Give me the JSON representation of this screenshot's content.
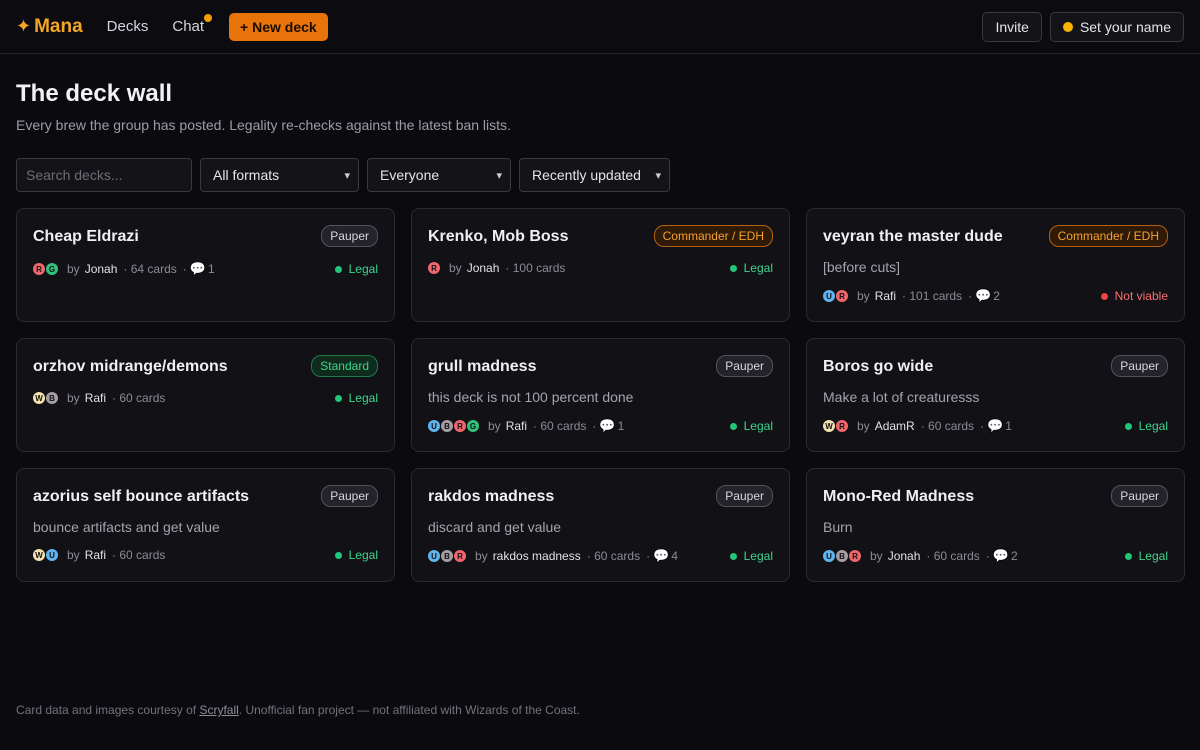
{
  "app": {
    "brand_icon": "✦",
    "brand_name": "Mana"
  },
  "nav": {
    "decks_label": "Decks",
    "chat_label": "Chat",
    "new_deck_label": "+ New deck"
  },
  "header_actions": {
    "invite_label": "Invite",
    "set_name_label": "Set your name"
  },
  "page": {
    "title": "The deck wall",
    "subtitle": "Every brew the group has posted. Legality re-checks against the latest ban lists."
  },
  "filters": {
    "search_placeholder": "Search decks...",
    "format_selected": "All formats",
    "owner_selected": "Everyone",
    "sort_selected": "Recently updated"
  },
  "decks": [
    {
      "title": "Cheap Eldrazi",
      "format": "Pauper",
      "format_style": "pauper",
      "description": "",
      "colors": [
        "R",
        "G"
      ],
      "by_label": "by",
      "author": "Jonah",
      "cards": "· 64 cards",
      "comments": "1",
      "status": "Legal",
      "status_ok": true
    },
    {
      "title": "Krenko, Mob Boss",
      "format": "Commander / EDH",
      "format_style": "edh",
      "description": "",
      "colors": [
        "R"
      ],
      "by_label": "by",
      "author": "Jonah",
      "cards": "· 100 cards",
      "comments": "",
      "status": "Legal",
      "status_ok": true
    },
    {
      "title": "veyran the master dude",
      "format": "Commander / EDH",
      "format_style": "edh",
      "description": "[before cuts]",
      "colors": [
        "U",
        "R"
      ],
      "by_label": "by",
      "author": "Rafi",
      "cards": "· 101 cards",
      "comments": "2",
      "status": "Not viable",
      "status_ok": false
    },
    {
      "title": "orzhov midrange/demons",
      "format": "Standard",
      "format_style": "standard",
      "description": "",
      "colors": [
        "W",
        "B"
      ],
      "by_label": "by",
      "author": "Rafi",
      "cards": "· 60 cards",
      "comments": "",
      "status": "Legal",
      "status_ok": true
    },
    {
      "title": "grull madness",
      "format": "Pauper",
      "format_style": "pauper",
      "description": "this deck is not 100 percent done",
      "colors": [
        "U",
        "B",
        "R",
        "G"
      ],
      "by_label": "by",
      "author": "Rafi",
      "cards": "· 60 cards",
      "comments": "1",
      "status": "Legal",
      "status_ok": true
    },
    {
      "title": "Boros go wide",
      "format": "Pauper",
      "format_style": "pauper",
      "description": "Make a lot of creaturesss",
      "colors": [
        "W",
        "R"
      ],
      "by_label": "by",
      "author": "AdamR",
      "cards": "· 60 cards",
      "comments": "1",
      "status": "Legal",
      "status_ok": true
    },
    {
      "title": "azorius self bounce artifacts",
      "format": "Pauper",
      "format_style": "pauper",
      "description": "bounce artifacts and get value",
      "colors": [
        "W",
        "U"
      ],
      "by_label": "by",
      "author": "Rafi",
      "cards": "· 60 cards",
      "comments": "",
      "status": "Legal",
      "status_ok": true
    },
    {
      "title": "rakdos madness",
      "format": "Pauper",
      "format_style": "pauper",
      "description": "discard and get value",
      "colors": [
        "U",
        "B",
        "R"
      ],
      "by_label": "by",
      "author": "rakdos madness",
      "cards": "· 60 cards",
      "comments": "4",
      "status": "Legal",
      "status_ok": true
    },
    {
      "title": "Mono-Red Madness",
      "format": "Pauper",
      "format_style": "pauper",
      "description": "Burn",
      "colors": [
        "U",
        "B",
        "R"
      ],
      "by_label": "by",
      "author": "Jonah",
      "cards": "· 60 cards",
      "comments": "2",
      "status": "Legal",
      "status_ok": true
    }
  ],
  "footer": {
    "prefix": "Card data and images courtesy of ",
    "link_text": "Scryfall",
    "suffix": ". Unofficial fan project — not affiliated with Wizards of the Coast."
  },
  "colors": {
    "brand": "#f5a524",
    "new_deck_button": "#e8730a",
    "legal": "#3dd68c",
    "not_viable": "#f87171"
  },
  "icons": {
    "comment": "speech-bubble-icon",
    "brand": "sparkle-icon",
    "chevron": "chevron-down-icon"
  }
}
